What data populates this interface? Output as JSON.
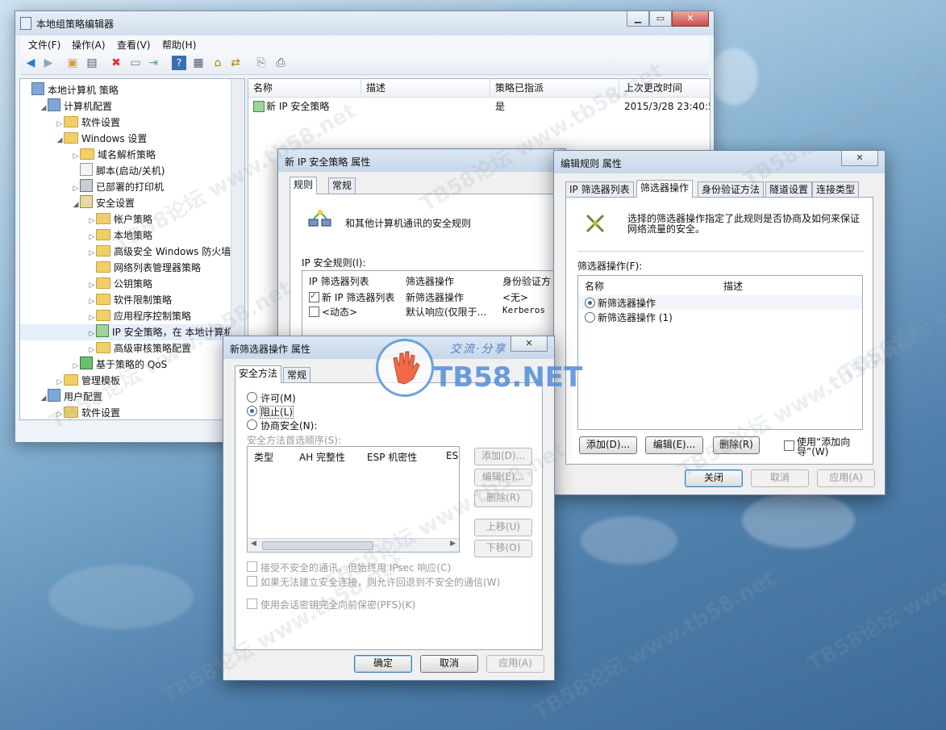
{
  "mmc": {
    "title": "本地组策略编辑器",
    "menu": [
      "文件(F)",
      "操作(A)",
      "查看(V)",
      "帮助(H)"
    ],
    "tree": [
      {
        "label": "本地计算机 策略",
        "level": 0,
        "icon": "computer-policy-icon"
      },
      {
        "label": "计算机配置",
        "level": 1,
        "icon": "computer-icon"
      },
      {
        "label": "软件设置",
        "level": 2,
        "icon": "folder-icon"
      },
      {
        "label": "Windows 设置",
        "level": 2,
        "icon": "folder-icon"
      },
      {
        "label": "域名解析策略",
        "level": 3,
        "icon": "folder-icon"
      },
      {
        "label": "脚本(启动/关机)",
        "level": 3,
        "icon": "script-icon"
      },
      {
        "label": "已部署的打印机",
        "level": 3,
        "icon": "printer-icon"
      },
      {
        "label": "安全设置",
        "level": 3,
        "icon": "security-icon"
      },
      {
        "label": "帐户策略",
        "level": 4,
        "icon": "folder-icon"
      },
      {
        "label": "本地策略",
        "level": 4,
        "icon": "folder-icon"
      },
      {
        "label": "高级安全 Windows 防火墙",
        "level": 4,
        "icon": "folder-icon"
      },
      {
        "label": "网络列表管理器策略",
        "level": 4,
        "icon": "folder-icon"
      },
      {
        "label": "公钥策略",
        "level": 4,
        "icon": "folder-icon"
      },
      {
        "label": "软件限制策略",
        "level": 4,
        "icon": "folder-icon"
      },
      {
        "label": "应用程序控制策略",
        "level": 4,
        "icon": "folder-icon"
      },
      {
        "label": "IP 安全策略，在 本地计算机",
        "level": 4,
        "icon": "ipsec-icon"
      },
      {
        "label": "高级审核策略配置",
        "level": 4,
        "icon": "folder-icon"
      },
      {
        "label": "基于策略的 QoS",
        "level": 3,
        "icon": "qos-icon"
      },
      {
        "label": "管理模板",
        "level": 2,
        "icon": "folder-icon"
      },
      {
        "label": "用户配置",
        "level": 1,
        "icon": "user-icon"
      },
      {
        "label": "软件设置",
        "level": 2,
        "icon": "folder-icon"
      }
    ],
    "columns": [
      "名称",
      "描述",
      "策略已指派",
      "上次更改时间"
    ],
    "rows": [
      {
        "name": "新 IP 安全策略",
        "desc": "",
        "assigned": "是",
        "modified": "2015/3/28 23:40:5"
      }
    ]
  },
  "ipsec_props": {
    "title": "新 IP 安全策略 属性",
    "tabs": [
      "规则",
      "常规"
    ],
    "intro": "和其他计算机通讯的安全规则",
    "rules_label": "IP 安全规则(I):",
    "columns": [
      "IP 筛选器列表",
      "筛选器操作",
      "身份验证方"
    ],
    "rows": [
      {
        "checked": true,
        "list": "新 IP 筛选器列表",
        "action": "新筛选器操作",
        "auth": "<无>"
      },
      {
        "checked": false,
        "list": "<动态>",
        "action": "默认响应(仅限于...",
        "auth": "Kerberos"
      }
    ]
  },
  "edit_rule": {
    "title": "编辑规则 属性",
    "tabs": [
      "IP 筛选器列表",
      "筛选器操作",
      "身份验证方法",
      "隧道设置",
      "连接类型"
    ],
    "description": "选择的筛选器操作指定了此规则是否协商及如何来保证网络流量的安全。",
    "actions_label": "筛选器操作(F):",
    "columns": [
      "名称",
      "描述"
    ],
    "items": [
      {
        "label": "新筛选器操作",
        "selected": true
      },
      {
        "label": "新筛选器操作 (1)",
        "selected": false
      }
    ],
    "buttons": {
      "add": "添加(D)...",
      "edit": "编辑(E)...",
      "remove": "删除(R)"
    },
    "wizard": "使用“添加向导”(W)",
    "footer": {
      "close": "关闭",
      "cancel": "取消",
      "apply": "应用(A)"
    }
  },
  "filter_action": {
    "title": "新筛选器操作 属性",
    "tabs": [
      "安全方法",
      "常规"
    ],
    "radios": [
      {
        "label": "许可(M)",
        "selected": false
      },
      {
        "label": "阻止(L)",
        "selected": true
      },
      {
        "label": "协商安全(N):",
        "selected": false
      }
    ],
    "order_label": "安全方法首选顺序(S):",
    "columns": [
      "类型",
      "AH 完整性",
      "ESP 机密性",
      "ESI"
    ],
    "side_buttons": {
      "add": "添加(D)...",
      "edit": "编辑(E)...",
      "remove": "删除(R)",
      "up": "上移(U)",
      "down": "下移(O)"
    },
    "options": [
      "接受不安全的通讯，但始终用 IPsec 响应(C)",
      "如果无法建立安全连接，则允许回退到不安全的通信(W)",
      "使用会话密钥完全向前保密(PFS)(K)"
    ],
    "footer": {
      "ok": "确定",
      "cancel": "取消",
      "apply": "应用(A)"
    }
  },
  "watermark": {
    "logo_text": "TB58.NET",
    "slogan": "交流·分享",
    "repeat": "TB58论坛 www.tb58.net"
  }
}
